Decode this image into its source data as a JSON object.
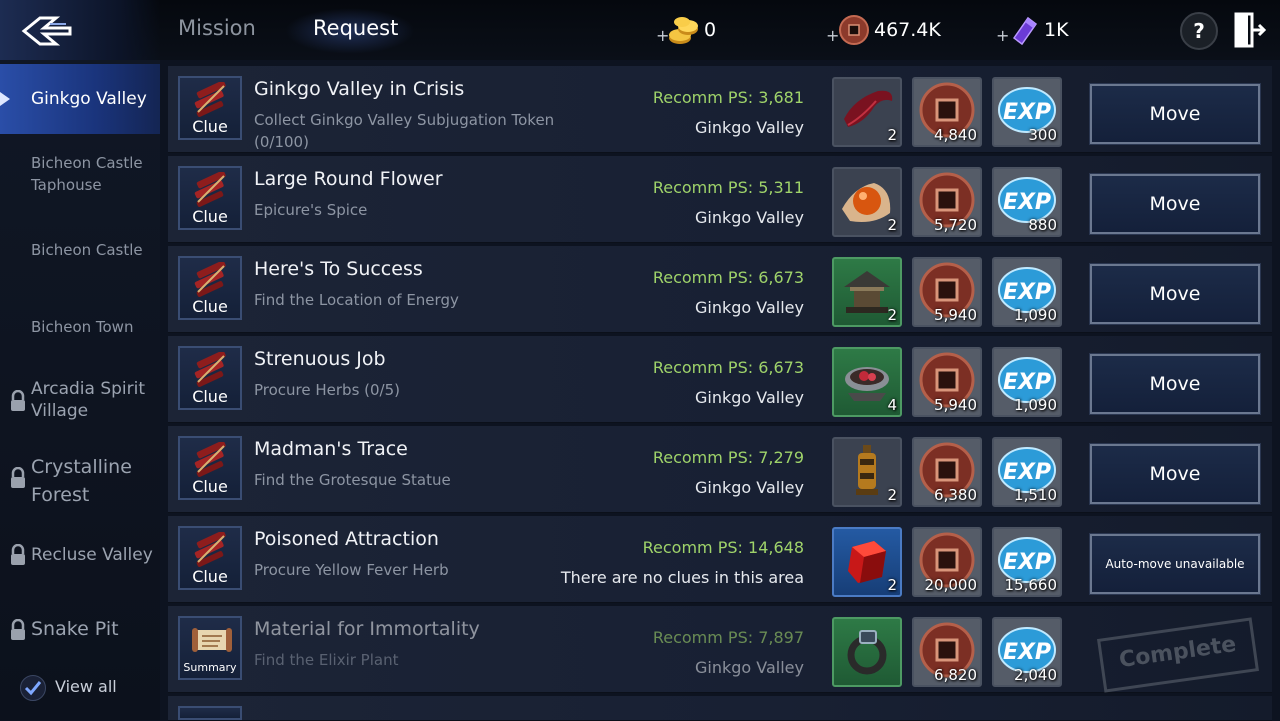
{
  "header": {
    "tabs": [
      {
        "label": "Mission",
        "active": false
      },
      {
        "label": "Request",
        "active": true
      }
    ],
    "currencies": [
      {
        "icon": "gold-coins-icon",
        "amount": "0"
      },
      {
        "icon": "copper-coin-icon",
        "amount": "467.4K"
      },
      {
        "icon": "purple-crystal-icon",
        "amount": "1K"
      }
    ],
    "help_label": "?"
  },
  "sidebar": {
    "items": [
      {
        "label": "Ginkgo Valley",
        "active": true,
        "locked": false
      },
      {
        "label": "Bicheon Castle Taphouse",
        "active": false,
        "locked": false
      },
      {
        "label": "Bicheon Castle",
        "active": false,
        "locked": false
      },
      {
        "label": "Bicheon Town",
        "active": false,
        "locked": false
      },
      {
        "label": "Arcadia Spirit Village",
        "active": false,
        "locked": true
      },
      {
        "label": "Crystalline Forest",
        "active": false,
        "locked": true
      },
      {
        "label": "Recluse Valley",
        "active": false,
        "locked": true
      },
      {
        "label": "Snake Pit",
        "active": false,
        "locked": true
      }
    ],
    "view_all": {
      "label": "View all",
      "checked": true
    }
  },
  "quests": [
    {
      "icon_label": "Clue",
      "title": "Ginkgo Valley in Crisis",
      "desc": "Collect Ginkgo Valley Subjugation Token (0/100)",
      "recomm": "Recomm PS: 3,681",
      "location": "Ginkgo Valley",
      "rewards": [
        {
          "icon": "red-feather-icon",
          "qty": "2"
        },
        {
          "icon": "copper-coin-icon",
          "qty": "4,840"
        },
        {
          "icon": "exp-icon",
          "qty": "300"
        }
      ],
      "action": "Move"
    },
    {
      "icon_label": "Clue",
      "title": "Large Round Flower",
      "desc": "Epicure's Spice",
      "recomm": "Recomm PS: 5,311",
      "location": "Ginkgo Valley",
      "rewards": [
        {
          "icon": "orange-orb-icon",
          "qty": "2"
        },
        {
          "icon": "copper-coin-icon",
          "qty": "5,720"
        },
        {
          "icon": "exp-icon",
          "qty": "880"
        }
      ],
      "action": "Move"
    },
    {
      "icon_label": "Clue",
      "title": "Here's To Success",
      "desc": "Find the Location of Energy",
      "recomm": "Recomm PS: 6,673",
      "location": "Ginkgo Valley",
      "rewards": [
        {
          "icon": "pavilion-icon",
          "qty": "2"
        },
        {
          "icon": "copper-coin-icon",
          "qty": "5,940"
        },
        {
          "icon": "exp-icon",
          "qty": "1,090"
        }
      ],
      "action": "Move"
    },
    {
      "icon_label": "Clue",
      "title": "Strenuous Job",
      "desc": "Procure Herbs (0/5)",
      "recomm": "Recomm PS: 6,673",
      "location": "Ginkgo Valley",
      "rewards": [
        {
          "icon": "herb-bowl-icon",
          "qty": "4"
        },
        {
          "icon": "copper-coin-icon",
          "qty": "5,940"
        },
        {
          "icon": "exp-icon",
          "qty": "1,090"
        }
      ],
      "action": "Move"
    },
    {
      "icon_label": "Clue",
      "title": "Madman's Trace",
      "desc": "Find the Grotesque Statue",
      "recomm": "Recomm PS: 7,279",
      "location": "Ginkgo Valley",
      "rewards": [
        {
          "icon": "lantern-icon",
          "qty": "2"
        },
        {
          "icon": "copper-coin-icon",
          "qty": "6,380"
        },
        {
          "icon": "exp-icon",
          "qty": "1,510"
        }
      ],
      "action": "Move"
    },
    {
      "icon_label": "Clue",
      "title": "Poisoned Attraction",
      "desc": "Procure Yellow Fever Herb",
      "recomm": "Recomm PS: 14,648",
      "location": "There are no clues in this area",
      "rewards": [
        {
          "icon": "red-cube-icon",
          "qty": "2"
        },
        {
          "icon": "copper-coin-icon",
          "qty": "20,000"
        },
        {
          "icon": "exp-icon",
          "qty": "15,660"
        }
      ],
      "action": "Auto-move unavailable"
    },
    {
      "icon_label": "Summary",
      "title": "Material for Immortality",
      "desc": "Find the Elixir Plant",
      "recomm": "Recomm PS: 7,897",
      "location": "Ginkgo Valley",
      "rewards": [
        {
          "icon": "ring-icon",
          "qty": ""
        },
        {
          "icon": "copper-coin-icon",
          "qty": "6,820"
        },
        {
          "icon": "exp-icon",
          "qty": "2,040"
        }
      ],
      "action": "Complete"
    }
  ]
}
